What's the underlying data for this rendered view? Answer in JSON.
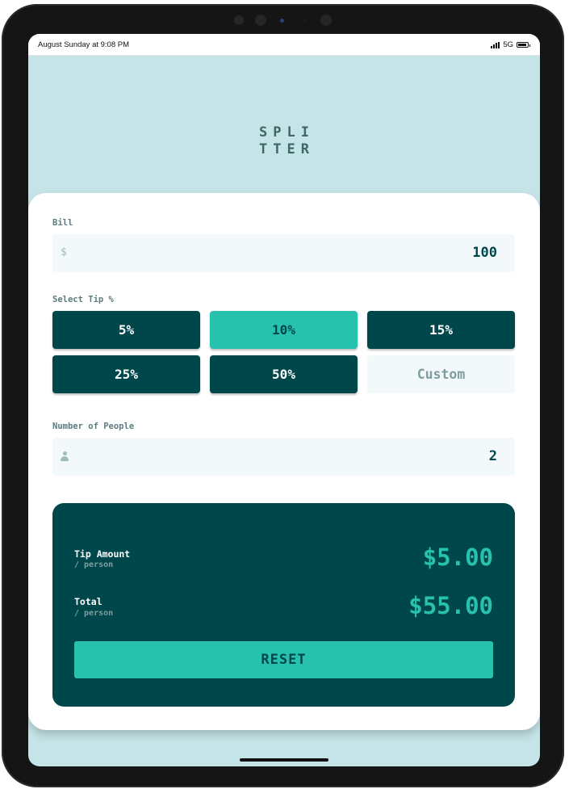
{
  "status_bar": {
    "time": "August Sunday at 9:08 PM",
    "network": "5G"
  },
  "logo": {
    "line1": "SPLI",
    "line2": "TTER"
  },
  "bill": {
    "label": "Bill",
    "currency": "$",
    "value": "100"
  },
  "tip": {
    "label": "Select Tip %",
    "options": [
      "5%",
      "10%",
      "15%",
      "25%",
      "50%"
    ],
    "selected": "10%",
    "custom_placeholder": "Custom"
  },
  "people": {
    "label": "Number of People",
    "value": "2"
  },
  "results": {
    "tip_label": "Tip Amount",
    "tip_sub": "/ person",
    "tip_value": "$5.00",
    "total_label": "Total",
    "total_sub": "/ person",
    "total_value": "$55.00",
    "reset_label": "RESET"
  },
  "colors": {
    "dark_cyan": "#00474b",
    "strong_cyan": "#26c2ae",
    "light_cyan_bg": "#c5e4e7",
    "input_bg": "#f3f9fa"
  }
}
